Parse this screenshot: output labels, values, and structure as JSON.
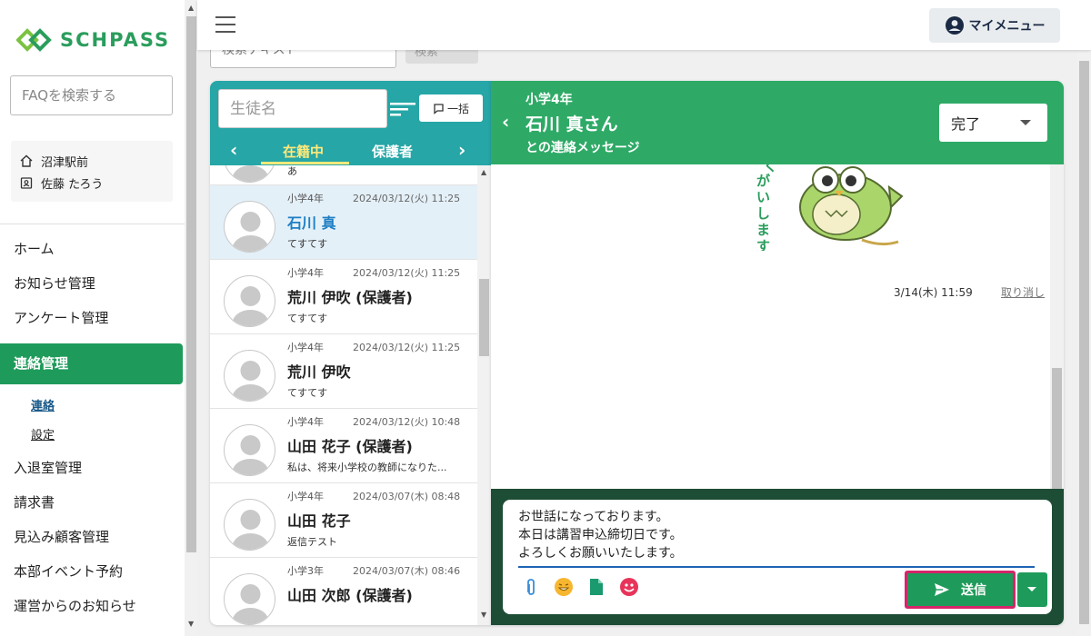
{
  "brand": {
    "logo_text": "SCHPASS",
    "color": "#2a9d5c"
  },
  "sidebar": {
    "faq_placeholder": "FAQを検索する",
    "school": "沼津駅前",
    "user": "佐藤 たろう",
    "items": [
      {
        "label": "ホーム"
      },
      {
        "label": "お知らせ管理"
      },
      {
        "label": "アンケート管理"
      },
      {
        "label": "連絡管理",
        "active": true
      },
      {
        "label": "入退室管理"
      },
      {
        "label": "請求書"
      },
      {
        "label": "見込み顧客管理"
      },
      {
        "label": "本部イベント予約"
      },
      {
        "label": "運営からのお知らせ"
      }
    ],
    "sub_items": [
      {
        "label": "連絡",
        "current": true
      },
      {
        "label": "設定"
      }
    ]
  },
  "topbar": {
    "mymenu_label": "マイメニュー"
  },
  "search_peek": {
    "text": "検索テキスト",
    "button": "検索"
  },
  "list": {
    "student_placeholder": "生徒名",
    "bulk_label": "一括",
    "tabs": [
      {
        "label": "在籍中",
        "active": true
      },
      {
        "label": "保護者"
      }
    ],
    "partial_preview": "あ",
    "items": [
      {
        "grade": "小学4年",
        "date": "2024/03/12(火) 11:25",
        "name": "石川 真",
        "preview": "てすてす",
        "selected": true
      },
      {
        "grade": "小学4年",
        "date": "2024/03/12(火) 11:25",
        "name": "荒川 伊吹 (保護者)",
        "preview": "てすてす"
      },
      {
        "grade": "小学4年",
        "date": "2024/03/12(火) 11:25",
        "name": "荒川 伊吹",
        "preview": "てすてす"
      },
      {
        "grade": "小学4年",
        "date": "2024/03/12(火) 10:48",
        "name": "山田 花子 (保護者)",
        "preview": "私は、将来小学校の教師になりた..."
      },
      {
        "grade": "小学4年",
        "date": "2024/03/07(木) 08:48",
        "name": "山田 花子",
        "preview": "返信テスト"
      },
      {
        "grade": "小学3年",
        "date": "2024/03/07(木) 08:46",
        "name": "山田 次郎 (保護者)",
        "preview": ""
      }
    ]
  },
  "chat": {
    "grade": "小学4年",
    "name": "石川 真さん",
    "subtitle": "との連絡メッセージ",
    "status": "完了",
    "stamp_text": "くおねがいします",
    "message_time": "3/14(木) 11:59",
    "undo_label": "取り消し",
    "compose_text": "お世話になっております。\n本日は講習申込締切日です。\nよろしくお願いいたします。",
    "send_label": "送信"
  }
}
